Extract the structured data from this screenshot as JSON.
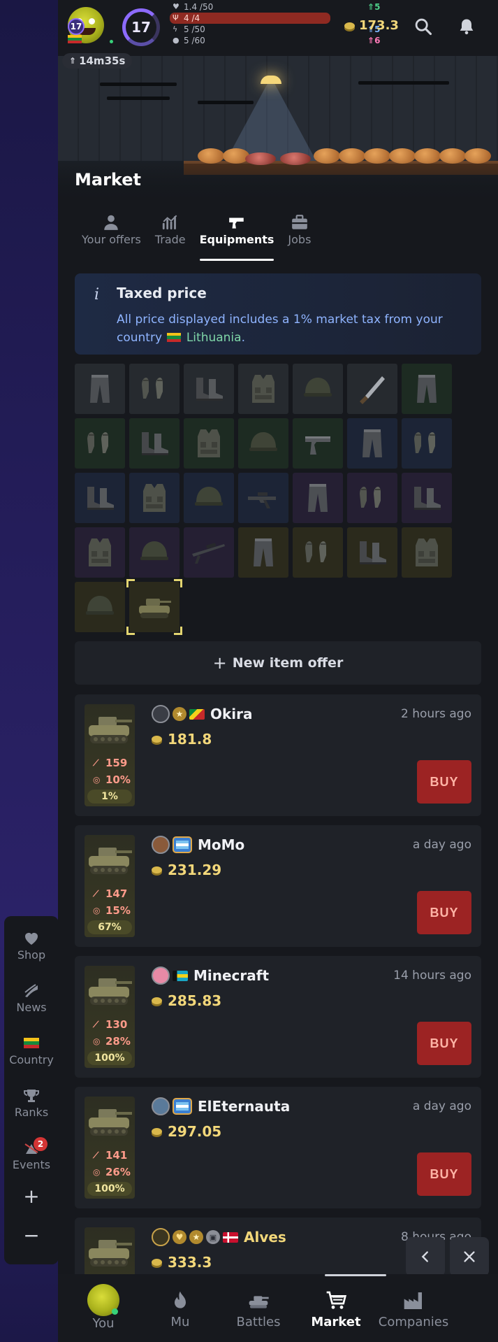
{
  "header": {
    "small_level": "17",
    "level": "17",
    "stats": [
      {
        "icon": "heart-icon",
        "value": "1.4 /50",
        "plus": "5",
        "plus_color": "green"
      },
      {
        "icon": "food-icon",
        "value": "4 /4",
        "plus": "",
        "plus_color": ""
      },
      {
        "icon": "energy-icon",
        "value": "5 /50",
        "plus": "5",
        "plus_color": "blue"
      },
      {
        "icon": "idea-icon",
        "value": "5 /60",
        "plus": "6",
        "plus_color": "pink"
      }
    ],
    "coins": "173.3",
    "timer": "14m35s"
  },
  "page": {
    "title": "Market"
  },
  "tabs": [
    {
      "label": "Your offers",
      "icon": "person-icon"
    },
    {
      "label": "Trade",
      "icon": "chart-icon"
    },
    {
      "label": "Equipments",
      "icon": "pistol-icon",
      "active": true
    },
    {
      "label": "Jobs",
      "icon": "briefcase-icon"
    }
  ],
  "info": {
    "title": "Taxed price",
    "text_before": "All price displayed includes a 1% market tax from your country",
    "country": "Lithuania",
    "text_after": "."
  },
  "new_offer_label": "New item offer",
  "offers": [
    {
      "seller": "Okira",
      "time": "2 hours ago",
      "price": "181.8",
      "attack": "159",
      "accuracy": "10%",
      "condition": "1%",
      "buy": "BUY"
    },
    {
      "seller": "MoMo",
      "time": "a day ago",
      "price": "231.29",
      "attack": "147",
      "accuracy": "15%",
      "condition": "67%",
      "buy": "BUY"
    },
    {
      "seller": "Minecraft",
      "time": "14 hours ago",
      "price": "285.83",
      "attack": "130",
      "accuracy": "28%",
      "condition": "100%",
      "buy": "BUY"
    },
    {
      "seller": "ElEternauta",
      "time": "a day ago",
      "price": "297.05",
      "attack": "141",
      "accuracy": "26%",
      "condition": "100%",
      "buy": "BUY"
    },
    {
      "seller": "Alves",
      "time": "8 hours ago",
      "price": "333.3"
    }
  ],
  "rail": {
    "shop": "Shop",
    "news": "News",
    "country": "Country",
    "ranks": "Ranks",
    "events": "Events",
    "events_badge": "2",
    "zoom_in": "+",
    "zoom_out": "−"
  },
  "bottom_nav": [
    {
      "label": "You"
    },
    {
      "label": "Mu"
    },
    {
      "label": "Battles"
    },
    {
      "label": "Market",
      "active": true
    },
    {
      "label": "Companies"
    }
  ],
  "colors": {
    "accent": "#8d6bff",
    "buy": "#9c2323",
    "coin": "#f2d77a",
    "rarity_grey": "#262a2f",
    "rarity_green": "#1d2b22",
    "rarity_blue": "#1c2436",
    "rarity_purple": "#251f33",
    "rarity_yellow": "#2b2a1c"
  }
}
